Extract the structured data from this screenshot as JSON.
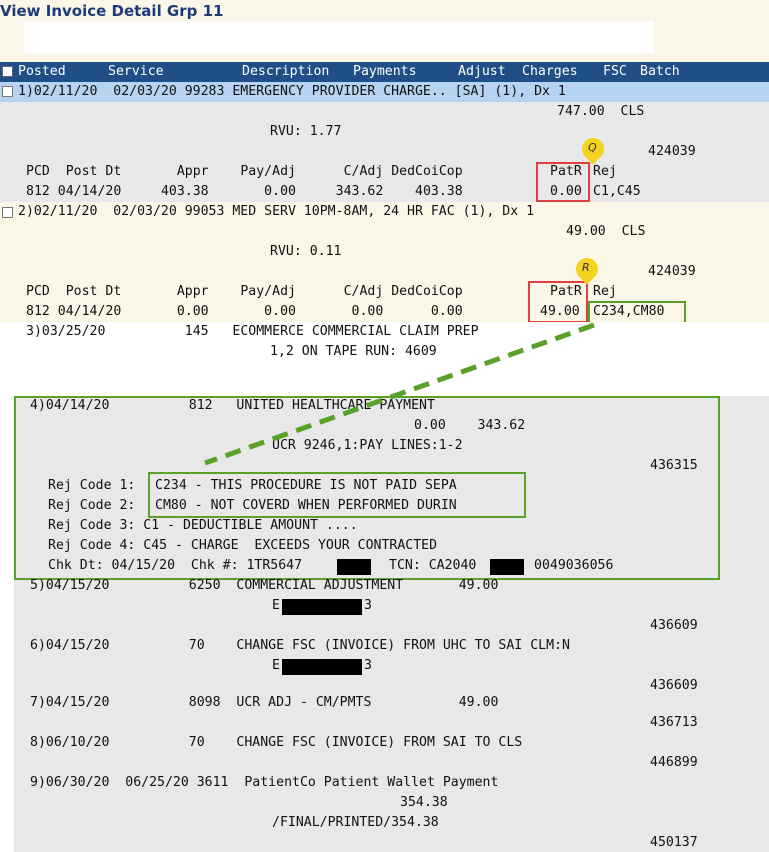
{
  "page": {
    "title": "View Invoice Detail Grp 11"
  },
  "header": {
    "cols": [
      "Posted",
      "Service",
      "Description",
      "Payments",
      "Adjust",
      "Charges",
      "FSC",
      "Batch"
    ]
  },
  "rows": {
    "r1": {
      "line": "1)02/11/20  02/03/20 99283 EMERGENCY PROVIDER CHARGE.. [SA] (1), Dx 1",
      "amount": "747.00  CLS",
      "rvu": "RVU: 1.77",
      "batch": "424039",
      "sub_head": "PCD  Post Dt       Appr    Pay/Adj      C/Adj DedCoiCop",
      "patr_label": "PatR",
      "rej_label": "Rej",
      "sub_vals": "812 04/14/20     403.38       0.00     343.62    403.38",
      "patr_val": "0.00",
      "rej_val": "C1,C45",
      "pin": "Q"
    },
    "r2": {
      "line": "2)02/11/20  02/03/20 99053 MED SERV 10PM-8AM, 24 HR FAC (1), Dx 1",
      "amount": "49.00  CLS",
      "rvu": "RVU: 0.11",
      "batch": "424039",
      "sub_head": "PCD  Post Dt       Appr    Pay/Adj      C/Adj DedCoiCop",
      "patr_label": "PatR",
      "rej_label": "Rej",
      "sub_vals": "812 04/14/20       0.00       0.00       0.00      0.00",
      "patr_val": "49.00",
      "rej_val": "C234,CM80",
      "pin": "R"
    },
    "r3": {
      "line": "3)03/25/20          145   ECOMMERCE COMMERCIAL CLAIM PREP",
      "sub": "1,2 ON TAPE RUN: 4609"
    },
    "r4": {
      "line": "4)04/14/20          812   UNITED HEALTHCARE PAYMENT",
      "amounts": "0.00    343.62",
      "ucr": "UCR 9246,1:PAY LINES:1-2",
      "batch": "436315",
      "rej1_label": "Rej Code 1:",
      "rej1": "C234 - THIS PROCEDURE IS NOT PAID SEPA",
      "rej2_label": "Rej Code 2:",
      "rej2": "CM80 - NOT COVERD WHEN PERFORMED DURIN",
      "rej3": "Rej Code 3: C1 - DEDUCTIBLE AMOUNT ....",
      "rej4": "Rej Code 4: C45 - CHARGE  EXCEEDS YOUR CONTRACTED",
      "chk_dt": "Chk Dt: 04/15/20  Chk #: 1TR5647",
      "tcn": "TCN: CA2040",
      "tcn_tail": "0049036056"
    },
    "r5": {
      "line": "5)04/15/20          6250  COMMERCIAL ADJUSTMENT       49.00",
      "code_prefix": "E",
      "code_suffix": "3",
      "batch": "436609"
    },
    "r6": {
      "line": "6)04/15/20          70    CHANGE FSC (INVOICE) FROM UHC TO SAI CLM:N",
      "code_prefix": "E",
      "code_suffix": "3",
      "batch": "436609"
    },
    "r7": {
      "line": "7)04/15/20          8098  UCR ADJ - CM/PMTS           49.00",
      "batch": "436713"
    },
    "r8": {
      "line": "8)06/10/20          70    CHANGE FSC (INVOICE) FROM SAI TO CLS",
      "batch": "446899"
    },
    "r9": {
      "line": "9)06/30/20  06/25/20 3611  PatientCo Patient Wallet Payment",
      "amount": "354.38",
      "final": "/FINAL/PRINTED/354.38",
      "batch": "450137"
    }
  },
  "colors": {
    "header_bg": "#1f4f86",
    "selected_row": "#b7d3f2",
    "cream": "#fbf7e8",
    "gray": "#e8e8e8",
    "red_box": "#e24040",
    "green_box": "#5aa12a",
    "pin": "#f3d320"
  }
}
